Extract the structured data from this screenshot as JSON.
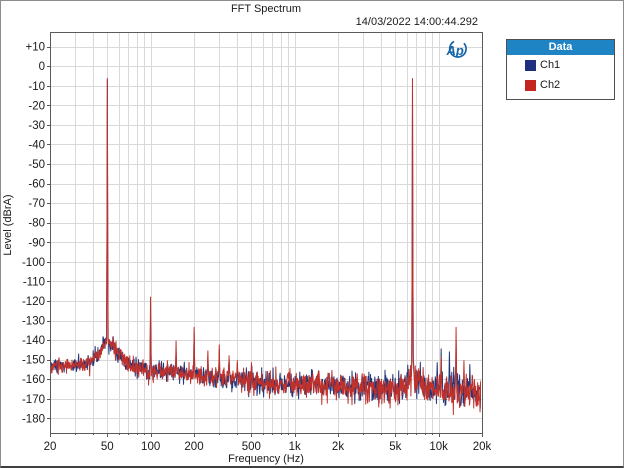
{
  "window": {
    "background": "#ffffff"
  },
  "header": {
    "title": "FFT Spectrum",
    "timestamp": "14/03/2022 14:00:44.292"
  },
  "logo": {
    "name": "audio-precision-logo",
    "text": "Ap",
    "color": "#1565a8"
  },
  "legend": {
    "title": "Data",
    "header_bg": "#1f84c4",
    "border_color": "#4f4f4f",
    "items": [
      {
        "label": "Ch1",
        "color": "#1f2f7e"
      },
      {
        "label": "Ch2",
        "color": "#c4261f"
      }
    ]
  },
  "chart_data": {
    "type": "line",
    "title": "FFT Spectrum",
    "xlabel": "Frequency (Hz)",
    "ylabel": "Level (dBrA)",
    "x_scale": "log",
    "xlim": [
      20,
      20000
    ],
    "ylim": [
      -187.5,
      17.5
    ],
    "grid": true,
    "grid_color": "#d9d9d9",
    "border_color": "#5a5a5a",
    "tick_color": "#5a5a5a",
    "text_color": "#1a1a1a",
    "legend_position": "outside-top-right",
    "x_ticks": [
      {
        "f": 20,
        "label": "20"
      },
      {
        "f": 50,
        "label": "50"
      },
      {
        "f": 100,
        "label": "100"
      },
      {
        "f": 200,
        "label": "200"
      },
      {
        "f": 500,
        "label": "500"
      },
      {
        "f": 1000,
        "label": "1k"
      },
      {
        "f": 2000,
        "label": "2k"
      },
      {
        "f": 5000,
        "label": "5k"
      },
      {
        "f": 10000,
        "label": "10k"
      },
      {
        "f": 20000,
        "label": "20k"
      }
    ],
    "y_ticks": [
      {
        "db": 10,
        "label": "+10"
      },
      {
        "db": 0,
        "label": "0"
      },
      {
        "db": -10,
        "label": "-10"
      },
      {
        "db": -20,
        "label": "-20"
      },
      {
        "db": -30,
        "label": "-30"
      },
      {
        "db": -40,
        "label": "-40"
      },
      {
        "db": -50,
        "label": "-50"
      },
      {
        "db": -60,
        "label": "-60"
      },
      {
        "db": -70,
        "label": "-70"
      },
      {
        "db": -80,
        "label": "-80"
      },
      {
        "db": -90,
        "label": "-90"
      },
      {
        "db": -100,
        "label": "-100"
      },
      {
        "db": -110,
        "label": "-110"
      },
      {
        "db": -120,
        "label": "-120"
      },
      {
        "db": -130,
        "label": "-130"
      },
      {
        "db": -140,
        "label": "-140"
      },
      {
        "db": -150,
        "label": "-150"
      },
      {
        "db": -160,
        "label": "-160"
      },
      {
        "db": -170,
        "label": "-170"
      },
      {
        "db": -180,
        "label": "-180"
      }
    ],
    "series": [
      {
        "name": "Ch1",
        "color": "#243578",
        "seed": 1234567,
        "peaks": [
          [
            50,
            -7.0
          ],
          [
            100,
            -128.5
          ],
          [
            150,
            -146
          ],
          [
            200,
            -136
          ],
          [
            250,
            -148.5
          ],
          [
            300,
            -145
          ],
          [
            350,
            -150
          ],
          [
            400,
            -152
          ],
          [
            500,
            -153
          ],
          [
            6550,
            -150
          ],
          [
            6600,
            -6.8
          ],
          [
            6650,
            -151
          ],
          [
            9800,
            -151.5
          ],
          [
            10400,
            -144.5
          ],
          [
            11900,
            -146
          ],
          [
            13200,
            -140.5
          ],
          [
            16500,
            -152.5
          ]
        ]
      },
      {
        "name": "Ch2",
        "color": "#c0312b",
        "seed": 987654,
        "peaks": [
          [
            50,
            -6.3
          ],
          [
            100,
            -118
          ],
          [
            150,
            -140.5
          ],
          [
            200,
            -133.5
          ],
          [
            250,
            -145.5
          ],
          [
            300,
            -142.5
          ],
          [
            350,
            -148
          ],
          [
            400,
            -150.5
          ],
          [
            500,
            -151.5
          ],
          [
            6550,
            -146
          ],
          [
            6600,
            -6.3
          ],
          [
            6650,
            -147.5
          ],
          [
            10400,
            -148.5
          ],
          [
            13200,
            -133.5
          ],
          [
            15000,
            -150.5
          ]
        ]
      }
    ],
    "main_tones": [
      {
        "freq_hz": 50,
        "level_db": -6.3
      },
      {
        "freq_hz": 6600,
        "level_db": -6.3
      }
    ],
    "noise_floor_envelope": [
      [
        20,
        -153
      ],
      [
        30,
        -153
      ],
      [
        38,
        -151
      ],
      [
        44,
        -146.5
      ],
      [
        48,
        -141.5
      ],
      [
        50,
        -139.5
      ],
      [
        53,
        -142
      ],
      [
        58,
        -146
      ],
      [
        65,
        -150
      ],
      [
        80,
        -154
      ],
      [
        100,
        -156
      ],
      [
        150,
        -157
      ],
      [
        200,
        -158
      ],
      [
        300,
        -159
      ],
      [
        500,
        -161
      ],
      [
        800,
        -162
      ],
      [
        1500,
        -163
      ],
      [
        3000,
        -164
      ],
      [
        5000,
        -165
      ],
      [
        6000,
        -162.5
      ],
      [
        6400,
        -158.5
      ],
      [
        6600,
        -155
      ],
      [
        6800,
        -158.5
      ],
      [
        7300,
        -162
      ],
      [
        8000,
        -164
      ],
      [
        10000,
        -165.5
      ],
      [
        14000,
        -166
      ],
      [
        20000,
        -166
      ]
    ],
    "noise_jitter_db": [
      [
        20,
        3.2
      ],
      [
        60,
        3.5
      ],
      [
        100,
        3.8
      ],
      [
        300,
        4.5
      ],
      [
        1000,
        5.5
      ],
      [
        3000,
        6.5
      ],
      [
        6600,
        7.0
      ],
      [
        20000,
        7.8
      ]
    ]
  }
}
